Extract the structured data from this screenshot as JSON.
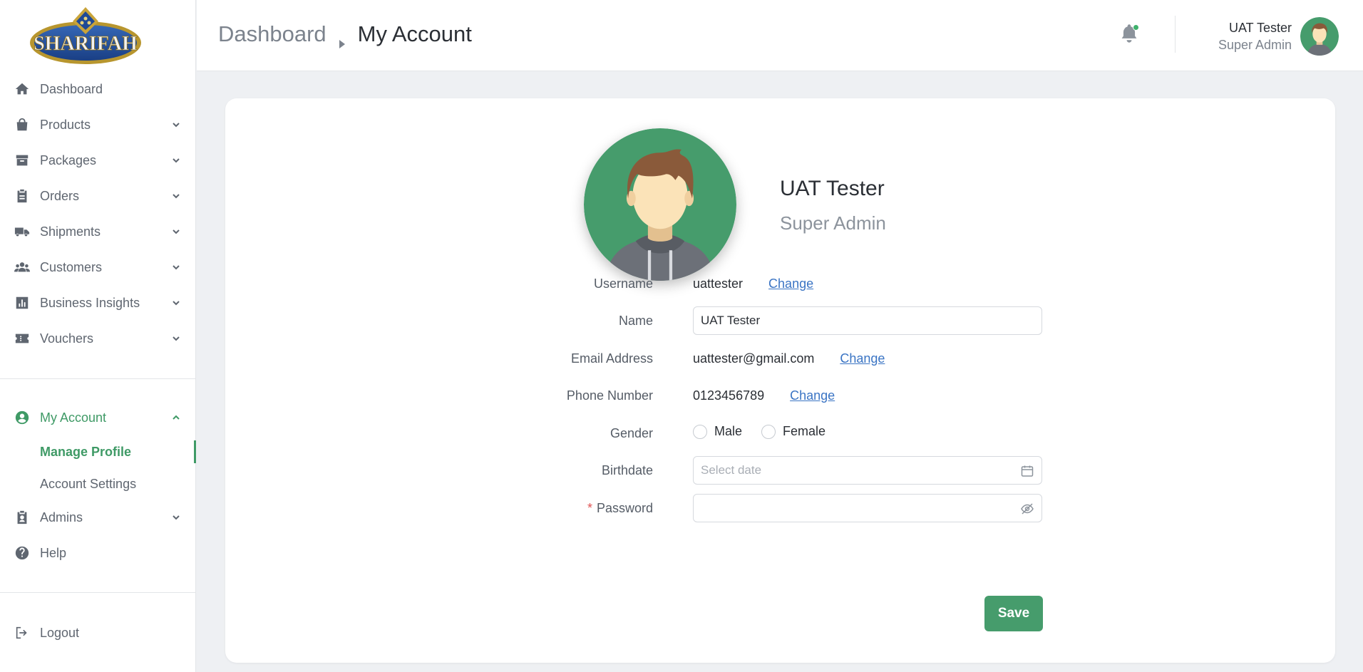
{
  "brand": {
    "logo_text": "SHARIFAH",
    "accent": "#3f9a66",
    "link": "#3a74c4"
  },
  "sidebar": {
    "items": [
      {
        "label": "Dashboard",
        "icon": "home-icon",
        "expandable": false
      },
      {
        "label": "Products",
        "icon": "shopping-bag-icon",
        "expandable": true
      },
      {
        "label": "Packages",
        "icon": "archive-box-icon",
        "expandable": true
      },
      {
        "label": "Orders",
        "icon": "clipboard-icon",
        "expandable": true
      },
      {
        "label": "Shipments",
        "icon": "truck-icon",
        "expandable": true
      },
      {
        "label": "Customers",
        "icon": "users-icon",
        "expandable": true
      },
      {
        "label": "Business Insights",
        "icon": "chart-bar-icon",
        "expandable": true
      },
      {
        "label": "Vouchers",
        "icon": "ticket-icon",
        "expandable": true
      }
    ],
    "account": {
      "label": "My Account",
      "icon": "user-circle-icon",
      "expanded": true,
      "children": [
        {
          "label": "Manage Profile",
          "current": true
        },
        {
          "label": "Account Settings",
          "current": false
        }
      ]
    },
    "admins_label": "Admins",
    "help_label": "Help",
    "logout_label": "Logout"
  },
  "header": {
    "breadcrumb": [
      "Dashboard",
      "My Account"
    ],
    "user_name": "UAT Tester",
    "user_role": "Super Admin",
    "notification_dot": true
  },
  "profile": {
    "name": "UAT Tester",
    "role": "Super Admin",
    "fields": {
      "username": {
        "label": "Username",
        "value": "uattester",
        "action": "Change"
      },
      "name": {
        "label": "Name",
        "value": "UAT Tester"
      },
      "email": {
        "label": "Email Address",
        "value": "uattester@gmail.com",
        "action": "Change"
      },
      "phone": {
        "label": "Phone Number",
        "value": "0123456789",
        "action": "Change"
      },
      "gender": {
        "label": "Gender",
        "options": [
          "Male",
          "Female"
        ],
        "selected": null
      },
      "birthdate": {
        "label": "Birthdate",
        "placeholder": "Select date",
        "value": ""
      },
      "password": {
        "label": "Password",
        "required_mark": "*",
        "value": ""
      }
    },
    "save_label": "Save"
  }
}
